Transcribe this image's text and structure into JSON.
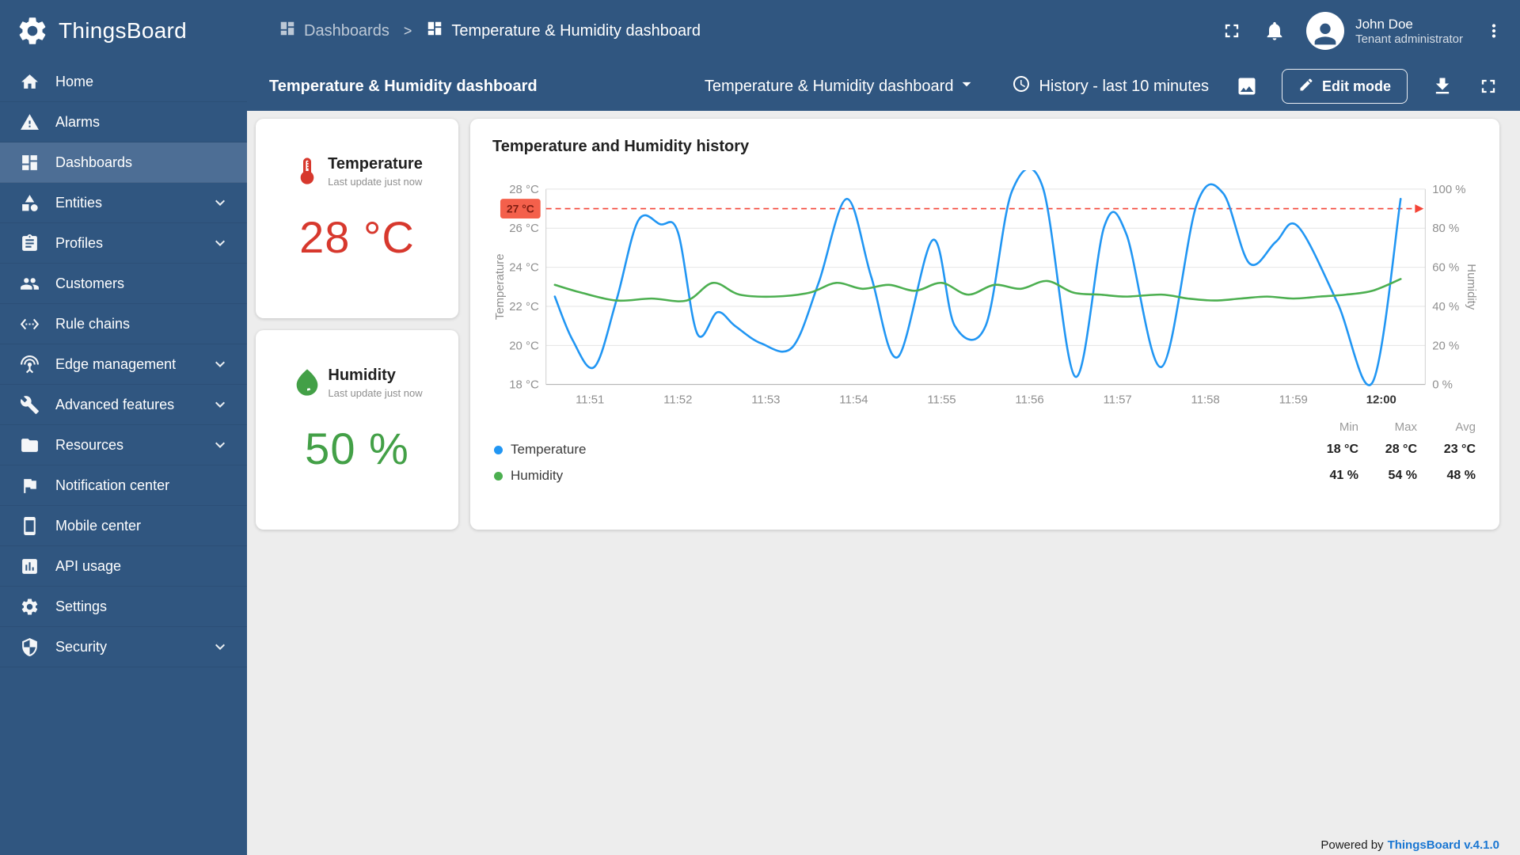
{
  "colors": {
    "primary": "#305680",
    "sidebar_active": "#4d6e95",
    "content_bg": "#ededed",
    "temperature_accent": "#d7382d",
    "humidity_accent": "#43a047",
    "link": "#1976d2"
  },
  "brand": {
    "name": "ThingsBoard",
    "logo_icon": "gear-logo-icon"
  },
  "header": {
    "breadcrumb": [
      {
        "icon": "dashboards-icon",
        "label": "Dashboards"
      },
      {
        "icon": "dashboards-icon",
        "label": "Temperature & Humidity dashboard"
      }
    ],
    "breadcrumb_separator": ">",
    "user": {
      "name": "John Doe",
      "role": "Tenant administrator"
    }
  },
  "toolbar": {
    "title": "Temperature & Humidity dashboard",
    "state_select": "Temperature & Humidity dashboard",
    "timewindow": "History - last 10 minutes",
    "edit_button": "Edit mode"
  },
  "sidebar": {
    "items": [
      {
        "label": "Home",
        "icon": "home-icon",
        "active": false,
        "expandable": false
      },
      {
        "label": "Alarms",
        "icon": "alarms-icon",
        "active": false,
        "expandable": false
      },
      {
        "label": "Dashboards",
        "icon": "dashboards-icon",
        "active": true,
        "expandable": false
      },
      {
        "label": "Entities",
        "icon": "entities-icon",
        "active": false,
        "expandable": true
      },
      {
        "label": "Profiles",
        "icon": "profiles-icon",
        "active": false,
        "expandable": true
      },
      {
        "label": "Customers",
        "icon": "customers-icon",
        "active": false,
        "expandable": false
      },
      {
        "label": "Rule chains",
        "icon": "rule-chains-icon",
        "active": false,
        "expandable": false
      },
      {
        "label": "Edge management",
        "icon": "edge-management-icon",
        "active": false,
        "expandable": true
      },
      {
        "label": "Advanced features",
        "icon": "advanced-features-icon",
        "active": false,
        "expandable": true
      },
      {
        "label": "Resources",
        "icon": "resources-icon",
        "active": false,
        "expandable": true
      },
      {
        "label": "Notification center",
        "icon": "notification-center-icon",
        "active": false,
        "expandable": false
      },
      {
        "label": "Mobile center",
        "icon": "mobile-center-icon",
        "active": false,
        "expandable": false
      },
      {
        "label": "API usage",
        "icon": "api-usage-icon",
        "active": false,
        "expandable": false
      },
      {
        "label": "Settings",
        "icon": "settings-icon",
        "active": false,
        "expandable": false
      },
      {
        "label": "Security",
        "icon": "security-icon",
        "active": false,
        "expandable": true
      }
    ]
  },
  "widgets": {
    "temperature": {
      "title": "Temperature",
      "subtitle": "Last update just now",
      "value": "28 °C"
    },
    "humidity": {
      "title": "Humidity",
      "subtitle": "Last update just now",
      "value": "50 %"
    }
  },
  "chart_data": {
    "type": "line",
    "title": "Temperature and Humidity history",
    "x_axis": {
      "range": [
        0,
        10
      ],
      "ticks": [
        {
          "x": 0.5,
          "label": "11:51",
          "bold": false
        },
        {
          "x": 1.5,
          "label": "11:52",
          "bold": false
        },
        {
          "x": 2.5,
          "label": "11:53",
          "bold": false
        },
        {
          "x": 3.5,
          "label": "11:54",
          "bold": false
        },
        {
          "x": 4.5,
          "label": "11:55",
          "bold": false
        },
        {
          "x": 5.5,
          "label": "11:56",
          "bold": false
        },
        {
          "x": 6.5,
          "label": "11:57",
          "bold": false
        },
        {
          "x": 7.5,
          "label": "11:58",
          "bold": false
        },
        {
          "x": 8.5,
          "label": "11:59",
          "bold": false
        },
        {
          "x": 9.5,
          "label": "12:00",
          "bold": true
        }
      ]
    },
    "y_left": {
      "label": "Temperature",
      "min": 18,
      "max": 28,
      "unit": "°C",
      "ticks": [
        18,
        20,
        22,
        24,
        26,
        28
      ]
    },
    "y_right": {
      "label": "Humidity",
      "min": 0,
      "max": 100,
      "unit": "%",
      "ticks": [
        0,
        20,
        40,
        60,
        80,
        100
      ]
    },
    "threshold": {
      "value": 27,
      "label": "27 °C",
      "color": "#f44336",
      "badge_bg": "#f4604b"
    },
    "legend_columns": [
      "Min",
      "Max",
      "Avg"
    ],
    "series": [
      {
        "name": "Temperature",
        "color": "#2196f3",
        "axis": "left",
        "min": "18 °C",
        "max": "28 °C",
        "avg": "23 °C",
        "points": [
          [
            0.1,
            22.5
          ],
          [
            0.3,
            20.3
          ],
          [
            0.55,
            18.9
          ],
          [
            0.8,
            22.3
          ],
          [
            1.05,
            26.4
          ],
          [
            1.3,
            26.2
          ],
          [
            1.5,
            25.8
          ],
          [
            1.72,
            20.6
          ],
          [
            1.95,
            21.7
          ],
          [
            2.15,
            21.0
          ],
          [
            2.45,
            20.1
          ],
          [
            2.8,
            19.9
          ],
          [
            3.1,
            23.2
          ],
          [
            3.42,
            27.5
          ],
          [
            3.7,
            23.5
          ],
          [
            4.0,
            19.4
          ],
          [
            4.4,
            25.4
          ],
          [
            4.65,
            21.0
          ],
          [
            5.0,
            21.0
          ],
          [
            5.3,
            27.9
          ],
          [
            5.65,
            28.1
          ],
          [
            6.02,
            18.4
          ],
          [
            6.35,
            26.1
          ],
          [
            6.6,
            25.7
          ],
          [
            7.0,
            18.9
          ],
          [
            7.4,
            27.2
          ],
          [
            7.7,
            27.8
          ],
          [
            8.0,
            24.2
          ],
          [
            8.3,
            25.3
          ],
          [
            8.55,
            26.1
          ],
          [
            9.0,
            22.2
          ],
          [
            9.4,
            18.1
          ],
          [
            9.72,
            27.5
          ]
        ]
      },
      {
        "name": "Humidity",
        "color": "#4caf50",
        "axis": "right",
        "min": "41 %",
        "max": "54 %",
        "avg": "48 %",
        "points": [
          [
            0.1,
            51
          ],
          [
            0.4,
            47
          ],
          [
            0.8,
            43
          ],
          [
            1.2,
            44
          ],
          [
            1.6,
            43
          ],
          [
            1.9,
            52
          ],
          [
            2.2,
            46
          ],
          [
            2.6,
            45
          ],
          [
            3.0,
            47
          ],
          [
            3.3,
            52
          ],
          [
            3.6,
            49
          ],
          [
            3.9,
            51
          ],
          [
            4.2,
            48
          ],
          [
            4.5,
            52
          ],
          [
            4.8,
            46
          ],
          [
            5.1,
            51
          ],
          [
            5.4,
            49
          ],
          [
            5.7,
            53
          ],
          [
            6.0,
            47
          ],
          [
            6.3,
            46
          ],
          [
            6.6,
            45
          ],
          [
            7.0,
            46
          ],
          [
            7.3,
            44
          ],
          [
            7.6,
            43
          ],
          [
            7.9,
            44
          ],
          [
            8.2,
            45
          ],
          [
            8.5,
            44
          ],
          [
            8.8,
            45
          ],
          [
            9.1,
            46
          ],
          [
            9.4,
            48
          ],
          [
            9.72,
            54
          ]
        ]
      }
    ]
  },
  "footer": {
    "powered_by": "Powered by",
    "version": "ThingsBoard v.4.1.0"
  }
}
